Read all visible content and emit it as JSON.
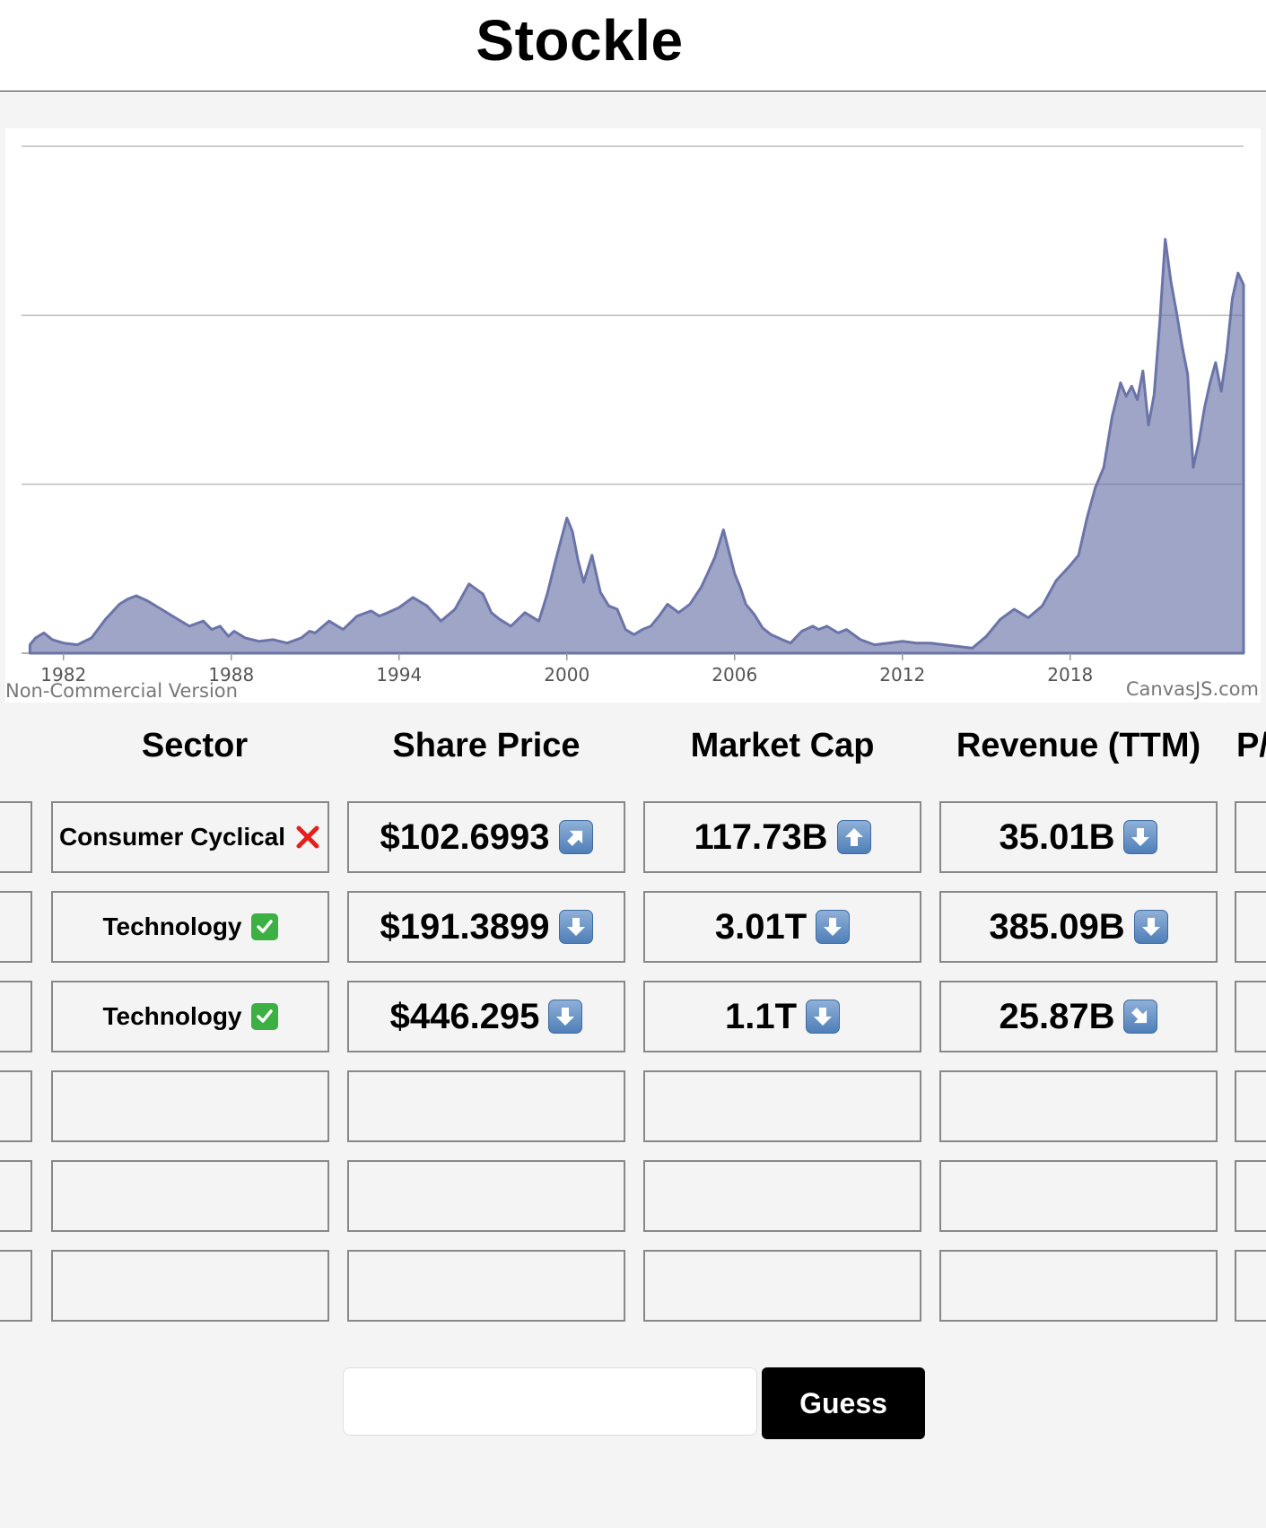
{
  "header": {
    "title": "Stockle"
  },
  "chart_data": {
    "type": "area",
    "title": "",
    "xlabel": "",
    "ylabel": "",
    "x_ticks": [
      "1982",
      "1988",
      "1994",
      "2000",
      "2006",
      "2012",
      "2018"
    ],
    "xlim": [
      1980.5,
      2024.2
    ],
    "ylim": [
      0,
      3
    ],
    "grid": true,
    "color": "#6b74a8",
    "watermark_left": "Non-Commercial Version",
    "watermark_right": "CanvasJS.com",
    "series": [
      {
        "x": [
          1980.8,
          1981.0,
          1981.3,
          1981.6,
          1982.0,
          1982.5,
          1983.0,
          1983.5,
          1984.0,
          1984.3,
          1984.6,
          1985.0,
          1985.5,
          1986.0,
          1986.5,
          1987.0,
          1987.3,
          1987.6,
          1987.9,
          1988.1,
          1988.5,
          1989.0,
          1989.5,
          1990.0,
          1990.5,
          1990.8,
          1991.0,
          1991.5,
          1992.0,
          1992.5,
          1993.0,
          1993.3,
          1993.6,
          1994.0,
          1994.5,
          1995.0,
          1995.5,
          1996.0,
          1996.5,
          1997.0,
          1997.3,
          1997.6,
          1998.0,
          1998.5,
          1999.0,
          1999.3,
          1999.6,
          2000.0,
          2000.2,
          2000.4,
          2000.6,
          2000.9,
          2001.2,
          2001.5,
          2001.8,
          2002.1,
          2002.4,
          2002.7,
          2003.0,
          2003.3,
          2003.6,
          2004.0,
          2004.4,
          2004.8,
          2005.0,
          2005.3,
          2005.6,
          2006.0,
          2006.2,
          2006.4,
          2006.7,
          2007.0,
          2007.3,
          2007.7,
          2008.0,
          2008.4,
          2008.8,
          2009.0,
          2009.3,
          2009.7,
          2010.0,
          2010.5,
          2011.0,
          2011.5,
          2012.0,
          2012.5,
          2013.0,
          2013.5,
          2014.0,
          2014.5,
          2015.0,
          2015.5,
          2016.0,
          2016.5,
          2017.0,
          2017.5,
          2018.0,
          2018.3,
          2018.6,
          2018.9,
          2019.2,
          2019.5,
          2019.8,
          2020.0,
          2020.2,
          2020.4,
          2020.6,
          2020.8,
          2021.0,
          2021.2,
          2021.4,
          2021.6,
          2021.8,
          2022.0,
          2022.2,
          2022.4,
          2022.6,
          2022.8,
          2023.0,
          2023.2,
          2023.4,
          2023.6,
          2023.8,
          2024.0,
          2024.2
        ],
        "values": [
          0.05,
          0.09,
          0.12,
          0.08,
          0.06,
          0.05,
          0.09,
          0.2,
          0.29,
          0.32,
          0.34,
          0.31,
          0.26,
          0.21,
          0.16,
          0.19,
          0.14,
          0.16,
          0.1,
          0.13,
          0.09,
          0.07,
          0.08,
          0.06,
          0.09,
          0.13,
          0.12,
          0.19,
          0.14,
          0.22,
          0.25,
          0.22,
          0.24,
          0.27,
          0.33,
          0.28,
          0.19,
          0.26,
          0.41,
          0.35,
          0.24,
          0.2,
          0.16,
          0.24,
          0.19,
          0.35,
          0.55,
          0.8,
          0.72,
          0.55,
          0.42,
          0.58,
          0.36,
          0.28,
          0.26,
          0.14,
          0.11,
          0.14,
          0.16,
          0.22,
          0.29,
          0.24,
          0.29,
          0.39,
          0.46,
          0.57,
          0.73,
          0.47,
          0.39,
          0.29,
          0.23,
          0.15,
          0.11,
          0.08,
          0.06,
          0.13,
          0.16,
          0.14,
          0.16,
          0.12,
          0.14,
          0.08,
          0.05,
          0.06,
          0.07,
          0.06,
          0.06,
          0.05,
          0.04,
          0.03,
          0.1,
          0.2,
          0.26,
          0.21,
          0.28,
          0.43,
          0.52,
          0.58,
          0.8,
          0.98,
          1.1,
          1.4,
          1.6,
          1.52,
          1.58,
          1.5,
          1.67,
          1.35,
          1.53,
          1.95,
          2.45,
          2.2,
          2.02,
          1.82,
          1.65,
          1.1,
          1.25,
          1.45,
          1.6,
          1.72,
          1.55,
          1.78,
          2.1,
          2.25,
          2.18
        ]
      }
    ]
  },
  "table": {
    "columns": [
      "Sector",
      "Share Price",
      "Market Cap",
      "Revenue (TTM)",
      "P/"
    ],
    "rows": [
      {
        "sector": {
          "text": "Consumer Cyclical",
          "status": "cross-mark-icon"
        },
        "share_price": {
          "text": "$102.6993",
          "icon": "up-right-arrow-icon"
        },
        "market_cap": {
          "text": "117.73B",
          "icon": "up-arrow-icon"
        },
        "revenue": {
          "text": "35.01B",
          "icon": "down-arrow-icon"
        }
      },
      {
        "sector": {
          "text": "Technology",
          "status": "check-mark-icon"
        },
        "share_price": {
          "text": "$191.3899",
          "icon": "down-arrow-icon"
        },
        "market_cap": {
          "text": "3.01T",
          "icon": "down-arrow-icon"
        },
        "revenue": {
          "text": "385.09B",
          "icon": "down-arrow-icon"
        }
      },
      {
        "sector": {
          "text": "Technology",
          "status": "check-mark-icon"
        },
        "share_price": {
          "text": "$446.295",
          "icon": "down-arrow-icon"
        },
        "market_cap": {
          "text": "1.1T",
          "icon": "down-arrow-icon"
        },
        "revenue": {
          "text": "25.87B",
          "icon": "down-right-arrow-icon"
        }
      }
    ],
    "empty_rows": 3
  },
  "guess": {
    "input_value": "",
    "button_label": "Guess"
  }
}
